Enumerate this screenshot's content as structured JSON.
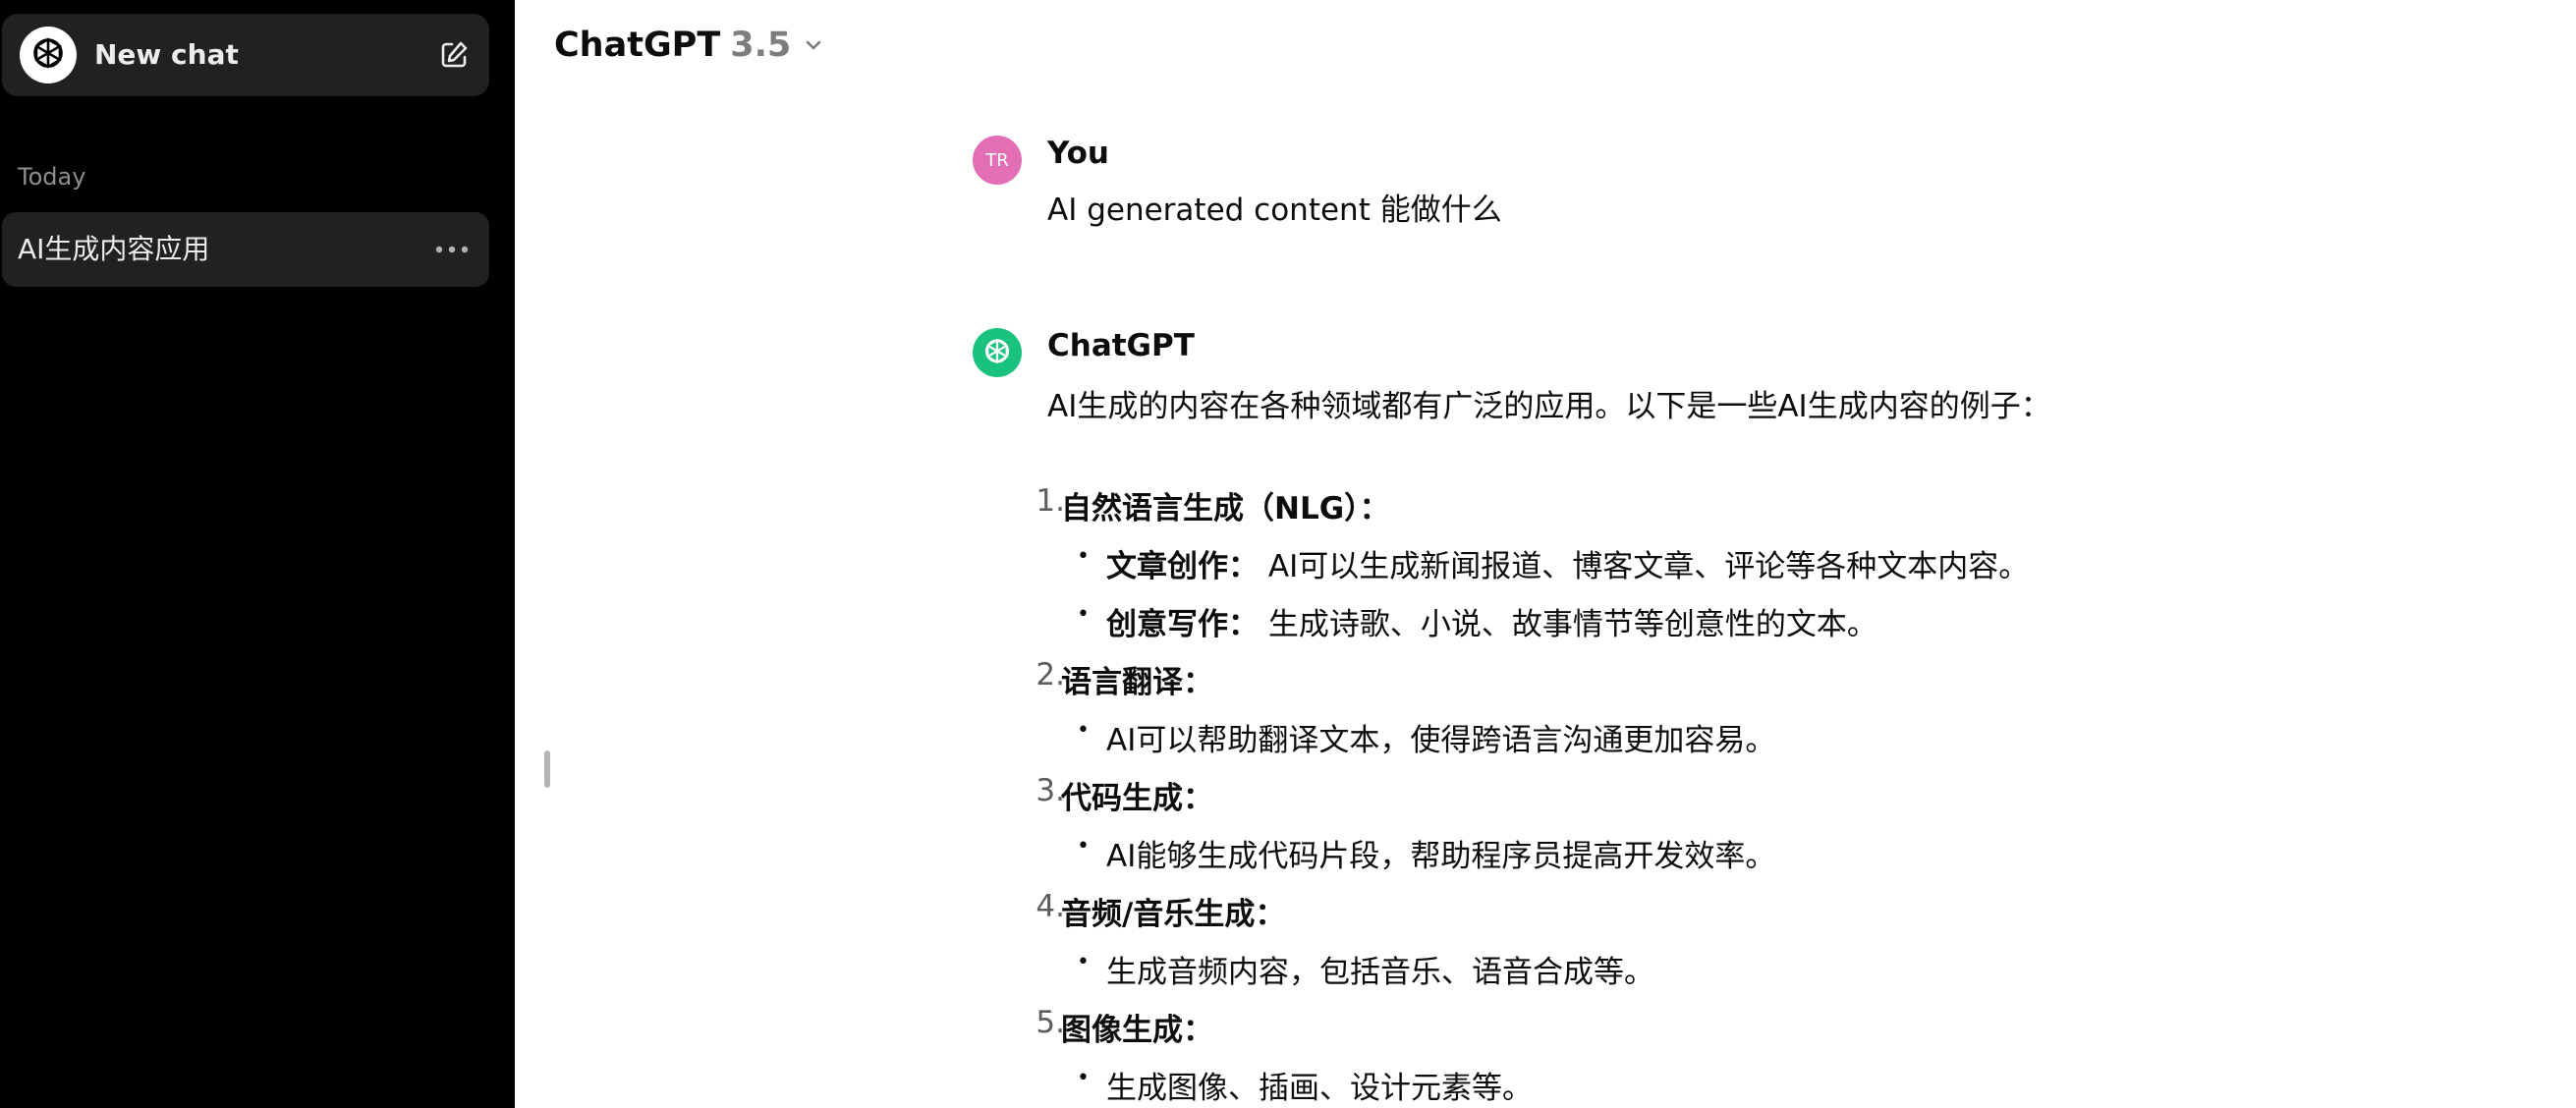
{
  "sidebar": {
    "new_chat_label": "New chat",
    "section_label": "Today",
    "history": [
      {
        "label": "AI生成内容应用"
      }
    ]
  },
  "header": {
    "model_name": "ChatGPT",
    "model_version": "3.5"
  },
  "conversation": {
    "user": {
      "avatar_initials": "TR",
      "author": "You",
      "text": "AI generated content 能做什么"
    },
    "assistant": {
      "author": "ChatGPT",
      "intro": "AI生成的内容在各种领域都有广泛的应用。以下是一些AI生成内容的例子：",
      "items": [
        {
          "num": "1.",
          "title": "自然语言生成（NLG）：",
          "subs": [
            {
              "bold": "文章创作：",
              "text": "AI可以生成新闻报道、博客文章、评论等各种文本内容。"
            },
            {
              "bold": "创意写作：",
              "text": "生成诗歌、小说、故事情节等创意性的文本。"
            }
          ]
        },
        {
          "num": "2.",
          "title": "语言翻译：",
          "subs": [
            {
              "bold": "",
              "text": "AI可以帮助翻译文本，使得跨语言沟通更加容易。"
            }
          ]
        },
        {
          "num": "3.",
          "title": "代码生成：",
          "subs": [
            {
              "bold": "",
              "text": "AI能够生成代码片段，帮助程序员提高开发效率。"
            }
          ]
        },
        {
          "num": "4.",
          "title": "音频/音乐生成：",
          "subs": [
            {
              "bold": "",
              "text": "生成音频内容，包括音乐、语音合成等。"
            }
          ]
        },
        {
          "num": "5.",
          "title": "图像生成：",
          "subs": [
            {
              "bold": "",
              "text": "生成图像、插画、设计元素等。"
            }
          ]
        }
      ]
    }
  },
  "colors": {
    "sidebar_bg": "#000000",
    "sidebar_item_bg": "#212121",
    "user_avatar": "#e26fb5",
    "assistant_avatar": "#19c37d"
  },
  "icons": {
    "logo": "openai-logo-icon",
    "new_chat": "edit-icon",
    "history_menu": "more-dots-icon",
    "model_dropdown": "chevron-down-icon"
  }
}
